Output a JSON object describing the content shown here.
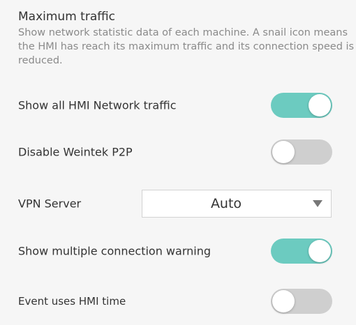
{
  "section": {
    "title": "Maximum traffic",
    "description": "Show network statistic data of each machine. A snail icon means the HMI has reach its maximum traffic and its connection speed is reduced."
  },
  "settings": {
    "show_all_traffic": {
      "label": "Show all HMI Network traffic",
      "enabled": true
    },
    "disable_p2p": {
      "label": "Disable Weintek P2P",
      "enabled": false
    },
    "vpn_server": {
      "label": "VPN Server",
      "value": "Auto"
    },
    "multiple_connection_warning": {
      "label": "Show multiple connection warning",
      "enabled": true
    },
    "event_hmi_time": {
      "label": "Event uses HMI time",
      "enabled": false
    }
  },
  "colors": {
    "toggle_on": "#6ccbc0",
    "toggle_off": "#cfcfcf",
    "panel_bg": "#f6f6f6"
  }
}
